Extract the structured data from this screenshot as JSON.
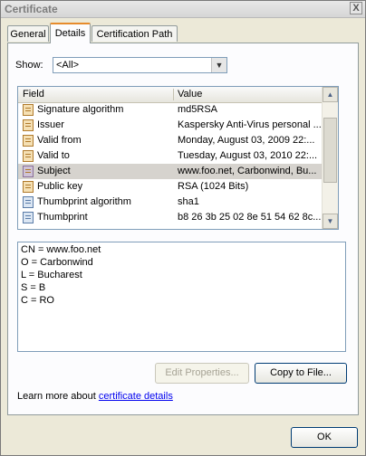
{
  "window": {
    "title": "Certificate",
    "close_label": "X"
  },
  "tabs": [
    {
      "label": "General"
    },
    {
      "label": "Details"
    },
    {
      "label": "Certification Path"
    }
  ],
  "show": {
    "label": "Show:",
    "value": "<All>",
    "arrow": "▼"
  },
  "list": {
    "headers": {
      "field": "Field",
      "value": "Value"
    },
    "rows": [
      {
        "field": "Signature algorithm",
        "value": "md5RSA"
      },
      {
        "field": "Issuer",
        "value": "Kaspersky Anti-Virus personal ..."
      },
      {
        "field": "Valid from",
        "value": "Monday, August 03, 2009 22:..."
      },
      {
        "field": "Valid to",
        "value": "Tuesday, August 03, 2010 22:..."
      },
      {
        "field": "Subject",
        "value": "www.foo.net, Carbonwind, Bu..."
      },
      {
        "field": "Public key",
        "value": "RSA (1024 Bits)"
      },
      {
        "field": "Thumbprint algorithm",
        "value": "sha1"
      },
      {
        "field": "Thumbprint",
        "value": "b8 26 3b 25 02 8e 51 54 62 8c..."
      }
    ],
    "scroll_up": "▲",
    "scroll_down": "▼"
  },
  "details": {
    "lines": [
      "CN = www.foo.net",
      "O = Carbonwind",
      "L = Bucharest",
      "S = B",
      "C = RO"
    ]
  },
  "buttons": {
    "edit_properties": "Edit Properties...",
    "copy_to_file": "Copy to File...",
    "ok": "OK"
  },
  "learn_more": {
    "prefix": "Learn more about ",
    "link": "certificate details"
  }
}
